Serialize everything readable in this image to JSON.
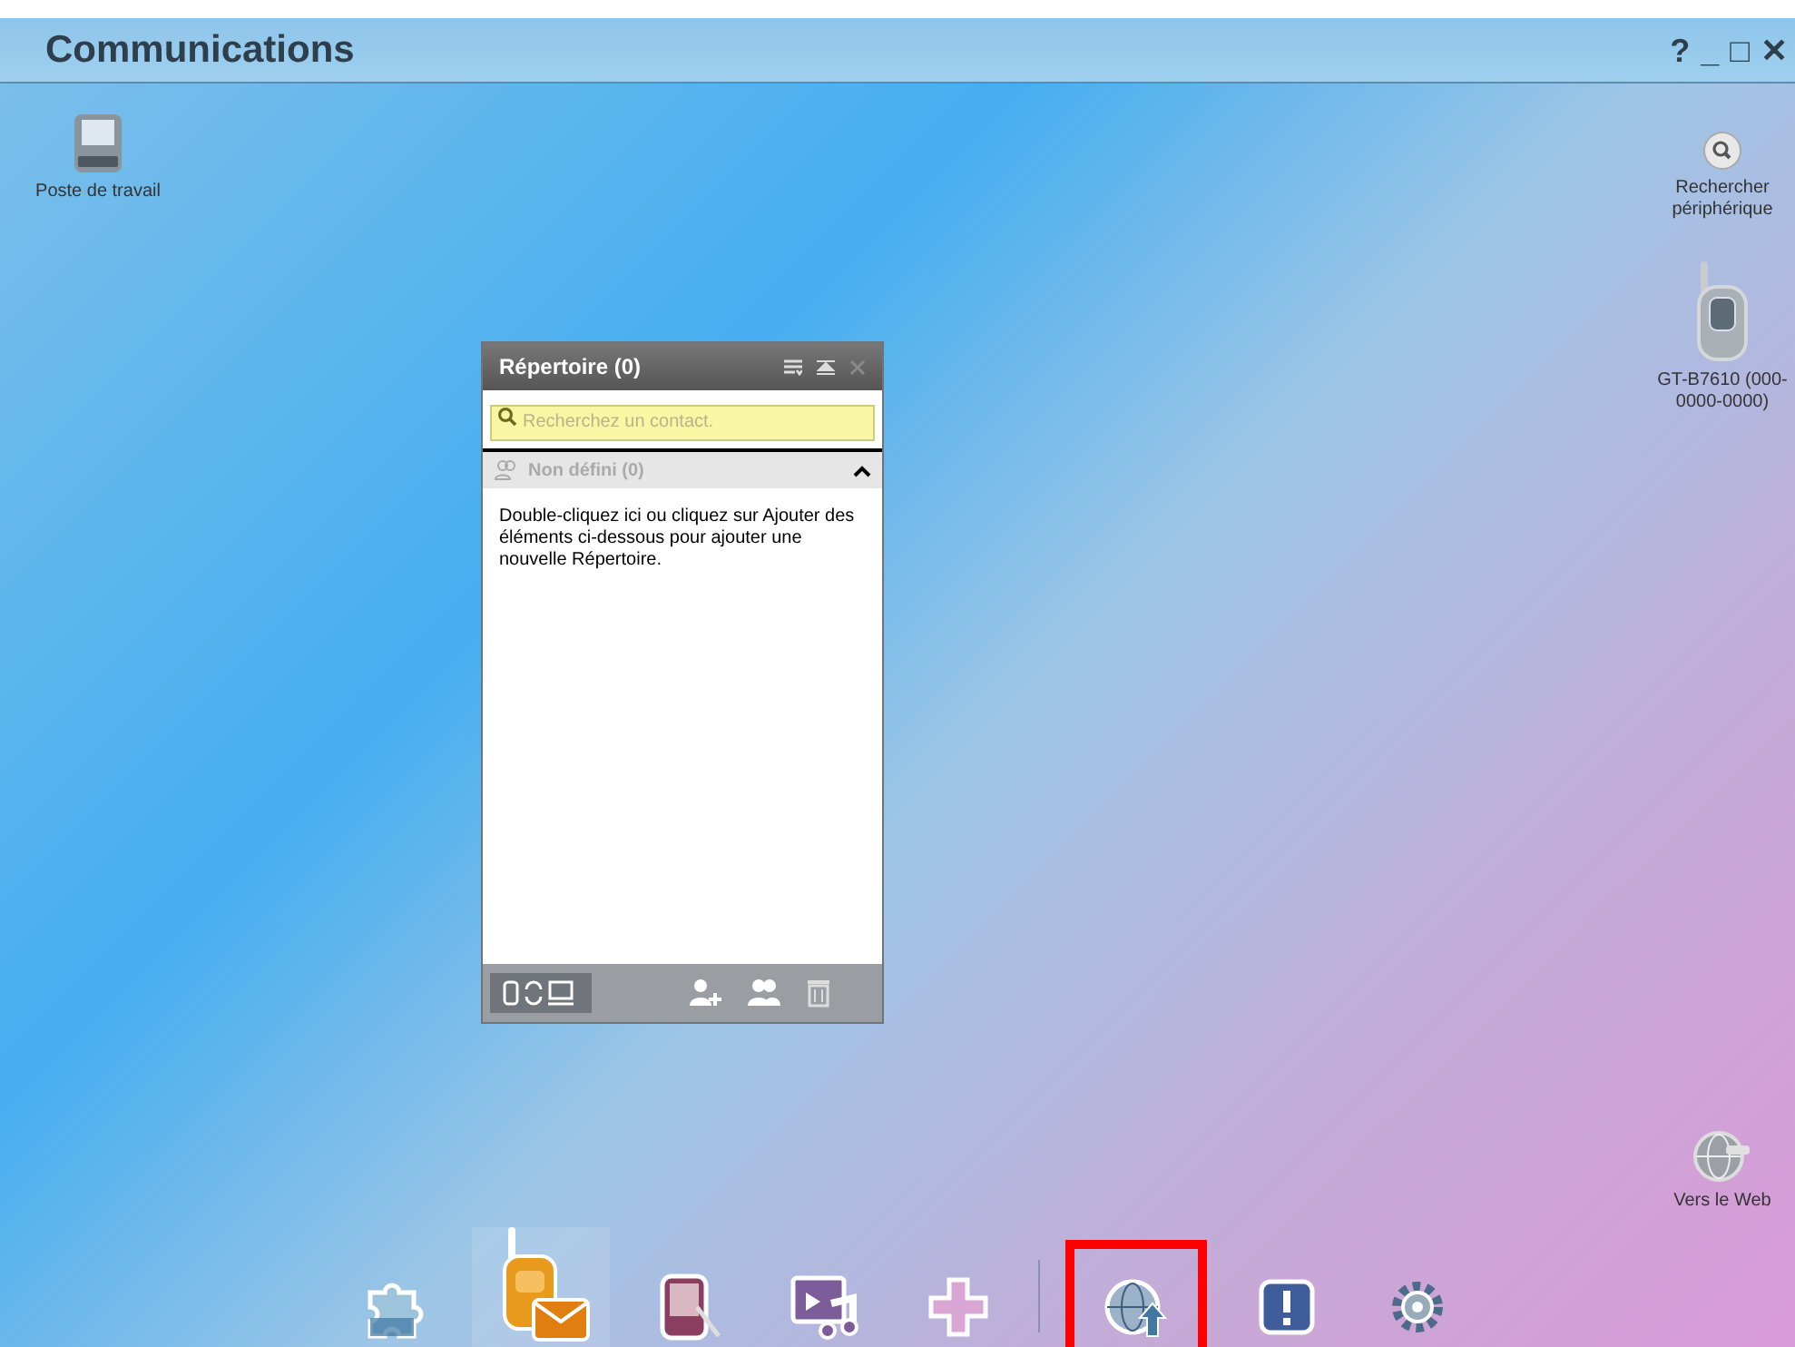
{
  "window": {
    "title": "Communications",
    "controls": [
      "?",
      "_",
      "□",
      "✕"
    ]
  },
  "desktop_icons": [
    {
      "kind": "computer",
      "label": "Poste de travail"
    },
    {
      "kind": "search",
      "label": "Rechercher périphérique"
    },
    {
      "kind": "phone",
      "label": "GT-B7610 (000-0000-0000)"
    },
    {
      "kind": "web",
      "label": "Vers le Web"
    }
  ],
  "phonebook": {
    "title": "Répertoire (0)",
    "search": {
      "placeholder": "Recherchez un contact."
    },
    "group": {
      "label": "Non défini (0)",
      "expanded": true
    },
    "message": "Double-cliquez ici ou cliquez sur Ajouter des éléments ci-dessous pour ajouter une nouvelle Répertoire."
  },
  "dock": [
    {
      "kind": "puzzle",
      "selected": false,
      "highlighted": false
    },
    {
      "kind": "phone-mail",
      "selected": true,
      "highlighted": false
    },
    {
      "kind": "pda",
      "selected": false,
      "highlighted": false
    },
    {
      "kind": "media",
      "selected": false,
      "highlighted": false
    },
    {
      "kind": "plus",
      "selected": false,
      "highlighted": false
    },
    {
      "kind": "globe-upload",
      "selected": false,
      "highlighted": true
    },
    {
      "kind": "alert",
      "selected": false,
      "highlighted": false
    },
    {
      "kind": "gear",
      "selected": false,
      "highlighted": false
    }
  ]
}
